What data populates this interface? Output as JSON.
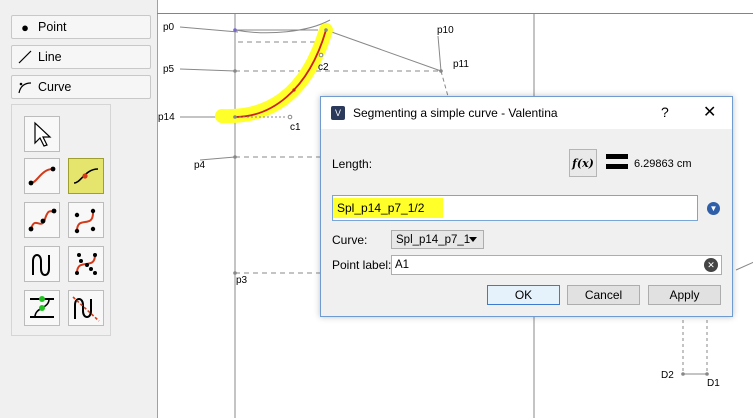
{
  "tools": {
    "point_label": "Point",
    "line_label": "Line",
    "curve_label": "Curve"
  },
  "canvas": {
    "points": {
      "p0": "p0",
      "p5": "p5",
      "p14": "p14",
      "p4": "p4",
      "p3": "p3",
      "p10": "p10",
      "p11": "p11",
      "c1": "c1",
      "c2": "c2",
      "d2": "D2",
      "d1": "D1"
    }
  },
  "dialog": {
    "title": "Segmenting a simple curve - Valentina",
    "help": "?",
    "close": "✕",
    "length_label": "Length:",
    "fx_label": "f(x)",
    "length_value": "6.29863 cm",
    "formula_value": "Spl_p14_p7_1/2",
    "curve_label": "Curve:",
    "curve_selected": "Spl_p14_p7_1",
    "point_label_label": "Point label:",
    "point_label_value": "A1",
    "ok_label": "OK",
    "cancel_label": "Cancel",
    "apply_label": "Apply"
  },
  "colors": {
    "highlight": "#ffff2a",
    "curve_red": "#cc1f1f",
    "active_tool": "#e5e56e",
    "dialog_border": "#6f9bd1"
  }
}
